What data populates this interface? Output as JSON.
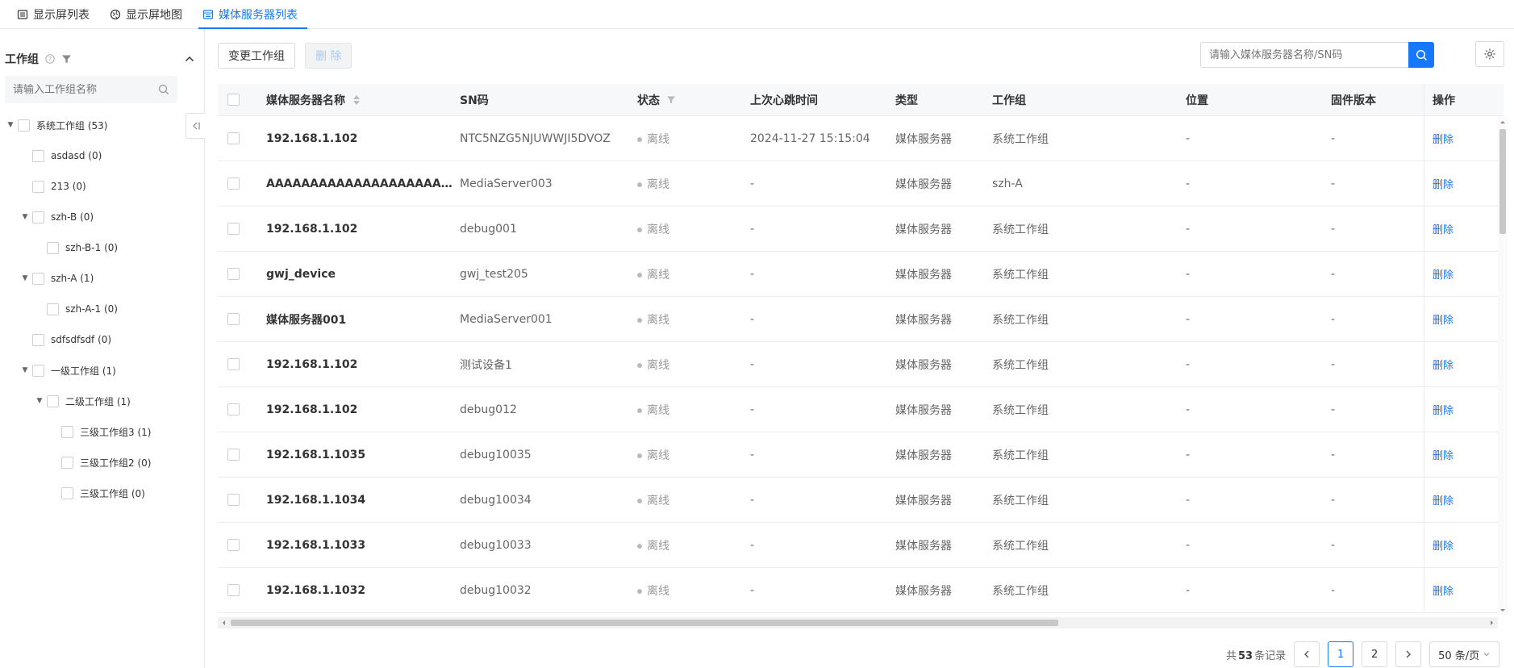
{
  "tabs": [
    {
      "label": "显示屏列表",
      "icon": "list-icon"
    },
    {
      "label": "显示屏地图",
      "icon": "map-icon"
    },
    {
      "label": "媒体服务器列表",
      "icon": "server-list-icon",
      "active": true
    }
  ],
  "sidebar": {
    "title": "工作组",
    "search_placeholder": "请输入工作组名称",
    "tree": [
      {
        "label": "系统工作组 (53)",
        "level": 0,
        "expanded": true
      },
      {
        "label": "asdasd (0)",
        "level": 1
      },
      {
        "label": "213 (0)",
        "level": 1
      },
      {
        "label": "szh-B (0)",
        "level": 1,
        "expanded": true
      },
      {
        "label": "szh-B-1 (0)",
        "level": 2
      },
      {
        "label": "szh-A (1)",
        "level": 1,
        "expanded": true
      },
      {
        "label": "szh-A-1 (0)",
        "level": 2
      },
      {
        "label": "sdfsdfsdf (0)",
        "level": 1
      },
      {
        "label": "一级工作组 (1)",
        "level": 1,
        "expanded": true
      },
      {
        "label": "二级工作组 (1)",
        "level": 2,
        "expanded": true
      },
      {
        "label": "三级工作组3 (1)",
        "level": 3
      },
      {
        "label": "三级工作组2 (0)",
        "level": 3
      },
      {
        "label": "三级工作组 (0)",
        "level": 3
      }
    ]
  },
  "toolbar": {
    "change_group_label": "变更工作组",
    "delete_label": "删 除",
    "search_placeholder": "请输入媒体服务器名称/SN码"
  },
  "table": {
    "headers": [
      "媒体服务器名称",
      "SN码",
      "状态",
      "上次心跳时间",
      "类型",
      "工作组",
      "位置",
      "固件版本",
      "操作"
    ],
    "action_label": "删除",
    "rows": [
      [
        "192.168.1.102",
        "NTC5NZG5NJUWWJI5DVOZ",
        "离线",
        "2024-11-27 15:15:04",
        "媒体服务器",
        "系统工作组",
        "-",
        "-"
      ],
      [
        "AAAAAAAAAAAAAAAAAAAAAA...",
        "MediaServer003",
        "离线",
        "-",
        "媒体服务器",
        "szh-A",
        "-",
        "-"
      ],
      [
        "192.168.1.102",
        "debug001",
        "离线",
        "-",
        "媒体服务器",
        "系统工作组",
        "-",
        "-"
      ],
      [
        "gwj_device",
        "gwj_test205",
        "离线",
        "-",
        "媒体服务器",
        "系统工作组",
        "-",
        "-"
      ],
      [
        "媒体服务器001",
        "MediaServer001",
        "离线",
        "-",
        "媒体服务器",
        "系统工作组",
        "-",
        "-"
      ],
      [
        "192.168.1.102",
        "测试设备1",
        "离线",
        "-",
        "媒体服务器",
        "系统工作组",
        "-",
        "-"
      ],
      [
        "192.168.1.102",
        "debug012",
        "离线",
        "-",
        "媒体服务器",
        "系统工作组",
        "-",
        "-"
      ],
      [
        "192.168.1.1035",
        "debug10035",
        "离线",
        "-",
        "媒体服务器",
        "系统工作组",
        "-",
        "-"
      ],
      [
        "192.168.1.1034",
        "debug10034",
        "离线",
        "-",
        "媒体服务器",
        "系统工作组",
        "-",
        "-"
      ],
      [
        "192.168.1.1033",
        "debug10033",
        "离线",
        "-",
        "媒体服务器",
        "系统工作组",
        "-",
        "-"
      ],
      [
        "192.168.1.1032",
        "debug10032",
        "离线",
        "-",
        "媒体服务器",
        "系统工作组",
        "-",
        "-"
      ]
    ]
  },
  "pagination": {
    "total_prefix": "共",
    "total": "53",
    "total_suffix": "条记录",
    "pages": [
      "1",
      "2"
    ],
    "current": "1",
    "page_size": "50 条/页"
  }
}
